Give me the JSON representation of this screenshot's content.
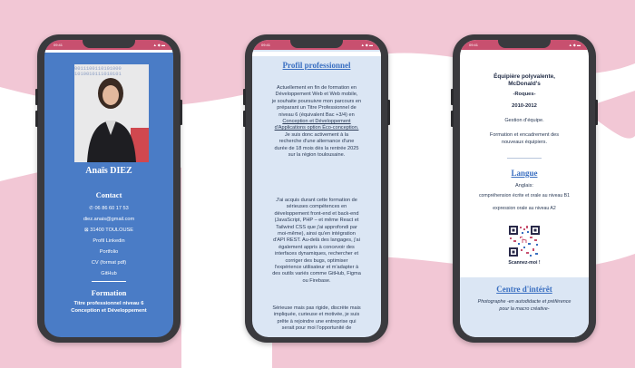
{
  "status": {
    "time": "09:41",
    "icons": "▲ ◆ ▬"
  },
  "colors": {
    "pink": "#f2c7d5",
    "accent": "#c8506f",
    "blue_panel": "#4a7cc6",
    "light_panel": "#dbe6f4"
  },
  "phone1": {
    "binary": "0011100110101000\n1010010111010101",
    "name": "Anaïs DIEZ",
    "contact_title": "Contact",
    "phone": "✆ 06 86 60 17 53",
    "email": "diez.anais@gmail.com",
    "address": "⊠ 31400 TOULOUSE",
    "links": [
      "Profil Linkedin",
      "Portfolio",
      "CV (format pdf)",
      "GitHub"
    ],
    "formation_title": "Formation",
    "formation_lines": [
      "Titre professionnel niveau 6",
      "Conception et Développement"
    ]
  },
  "phone2": {
    "title": "Profil professionnel",
    "p1_lines": [
      "Actuellement en fin de formation en",
      "Développement Web et Web mobile,",
      "je souhaite poursuivre mon parcours en",
      "préparant un Titre Professionnel de",
      "niveau 6 (équivalent Bac +3/4) en"
    ],
    "p1_link_lines": [
      "Conception et Développement",
      "d'Applications option Éco-conception."
    ],
    "p1_end_lines": [
      "Je suis donc activement à la",
      "recherche d'une alternance d'une",
      "durée de 18 mois dès la rentrée 2025",
      "sur la région toulousaine."
    ],
    "p2_lines": [
      "J'ai acquis durant cette formation de",
      "sérieuses compétences en",
      "développement front-end et back-end",
      "(JavaScript, PHP – et même React et",
      "Tailwind CSS que j'ai approfondi par",
      "moi-même), ainsi qu'en intégration",
      "d'API REST. Au-delà des langages, j'ai",
      "également appris à concevoir des",
      "interfaces dynamiques, rechercher et",
      "corriger des bugs, optimiser",
      "l'expérience utilisateur et m'adapter à",
      "des outils variés comme GitHub, Figma",
      "ou Firebase."
    ],
    "p3_lines": [
      "Sérieuse mais pas rigide, discrète mais",
      "impliquée, curieuse et motivée, je suis",
      "prête à rejoindre une entreprise qui",
      "serait pour moi l'opportunité de"
    ]
  },
  "phone3": {
    "job_title": "Équipière polyvalente,",
    "job_company": "McDonald's",
    "job_place": "-Roques-",
    "job_years": "2010-2012",
    "job_desc1": "Gestion d'équipe.",
    "job_desc2_lines": [
      "Formation et encadrement des",
      "nouveaux équipiers."
    ],
    "langue_title": "Langue",
    "lang_name": "Anglais:",
    "lang_written": "compréhension écrite et orale au niveau B1",
    "lang_oral": "expression orale au niveau A2",
    "qr_caption": "Scannez-moi !",
    "interests_title": "Centre d'intérêt",
    "interests_lines": [
      "Photographe -en autodidacte et préférence",
      "pour la macro créative-"
    ]
  }
}
